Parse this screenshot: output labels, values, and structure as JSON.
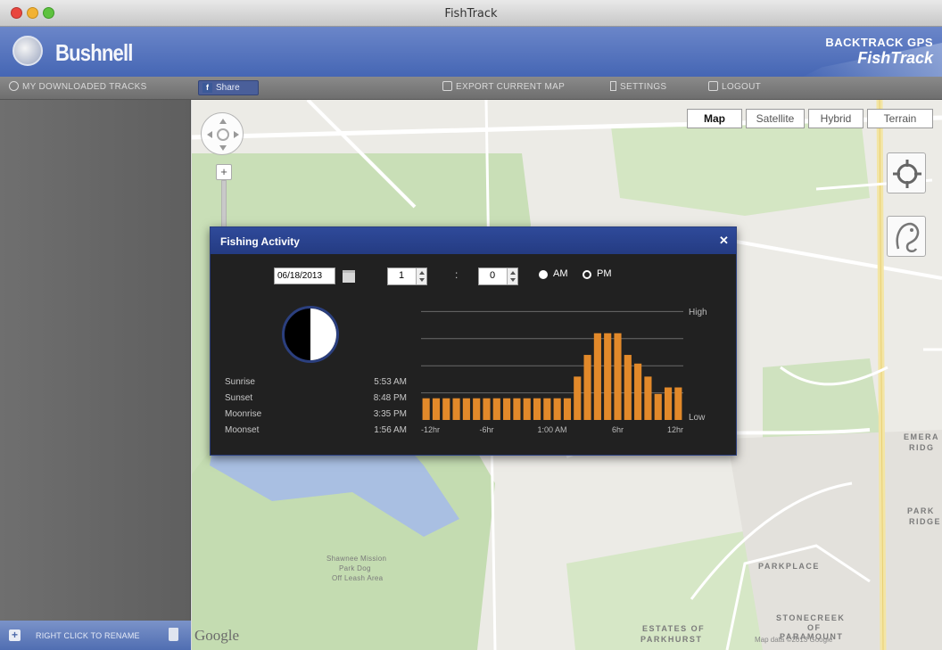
{
  "window": {
    "title": "FishTrack"
  },
  "header": {
    "logo_text": "Bushnell",
    "brand_line1": "BACKTRACK GPS",
    "brand_line2": "FishTrack"
  },
  "toolbar": {
    "saved_label": "MY DOWNLOADED TRACKS",
    "share_label": "Share",
    "export_label": "EXPORT CURRENT MAP",
    "settings_label": "SETTINGS",
    "logout_label": "LOGOUT"
  },
  "sidebar": {
    "footer_label": "RIGHT CLICK TO RENAME"
  },
  "map": {
    "types": [
      "Map",
      "Satellite",
      "Hybrid",
      "Terrain"
    ],
    "selected_type": "Map",
    "labels": {
      "emerald": "EMERA",
      "ridge": "RIDG",
      "park": "PARK",
      "ridge2": "RIDGE",
      "parkplace": "PARKPLACE",
      "stonecreek": "STONECREEK",
      "of": "OF",
      "paramount": "PARAMOUNT",
      "estates": "ESTATES OF",
      "parkhurst": "PARKHURST",
      "park_area_1": "Shawnee Mission",
      "park_area_2": "Park Dog",
      "park_area_3": "Off Leash Area"
    },
    "google_label": "Google",
    "copyright": "Map data ©2013 Google"
  },
  "dialog": {
    "title": "Fishing Activity",
    "close_label": "✕",
    "date": "06/18/2013",
    "hour": "1",
    "minute": "0",
    "am_label": "AM",
    "pm_label": "PM",
    "selected_period": "PM",
    "sun_moon": [
      {
        "label": "Sunrise",
        "value": "5:53 AM"
      },
      {
        "label": "Sunset",
        "value": "8:48 PM"
      },
      {
        "label": "Moonrise",
        "value": "3:35 PM"
      },
      {
        "label": "Moonset",
        "value": "1:56 AM"
      }
    ]
  },
  "chart_data": {
    "type": "bar",
    "categories": [
      "-12hr",
      "",
      "",
      "",
      "",
      "",
      "",
      "",
      "",
      "",
      "",
      "",
      "",
      "",
      "",
      "",
      "",
      "",
      "",
      "",
      "",
      "",
      "",
      "",
      "",
      "12hr"
    ],
    "xtick_labels": [
      "-12hr",
      "-6hr",
      "1:00 AM",
      "6hr",
      "12hr"
    ],
    "values": [
      1,
      1,
      1,
      1,
      1,
      1,
      1,
      1,
      1,
      1,
      1,
      1,
      1,
      1,
      1,
      2,
      3,
      4,
      4,
      4,
      3,
      2.6,
      2,
      1.2,
      1.5,
      1.5
    ],
    "ylabels": {
      "high": "High",
      "low": "Low"
    },
    "ylim": [
      0,
      5
    ],
    "bar_color": "#e2892a",
    "grid": true,
    "title": "",
    "xlabel": "",
    "ylabel": ""
  }
}
